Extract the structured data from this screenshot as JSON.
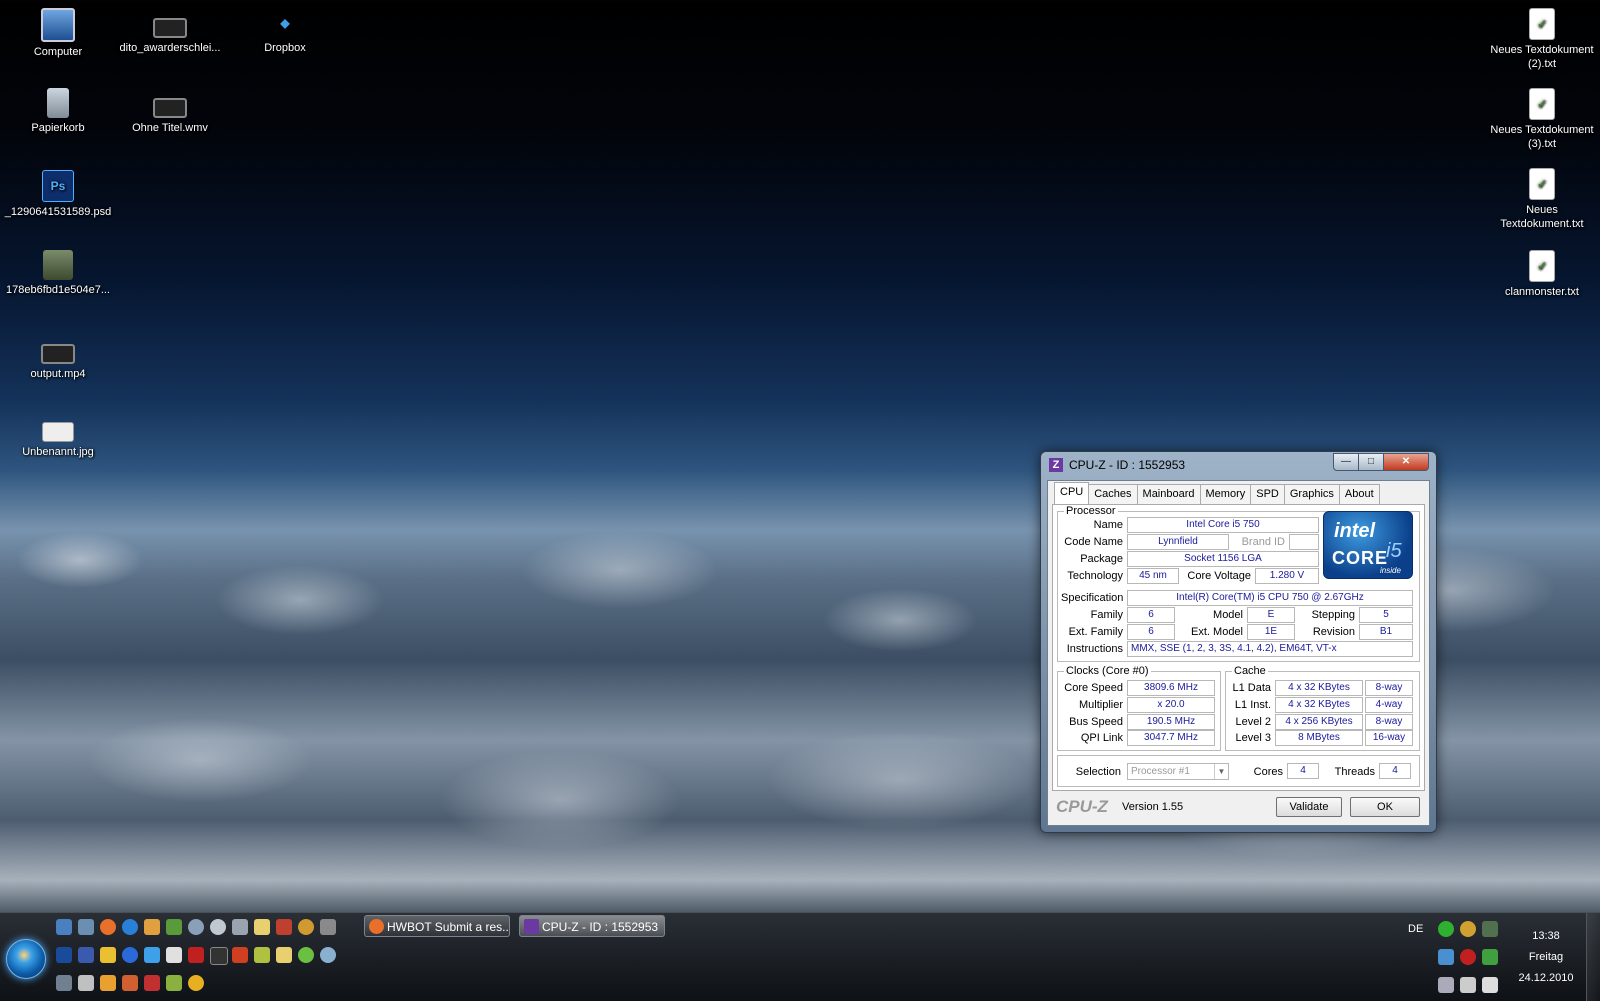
{
  "desktop_icons_left": [
    {
      "label": "Computer",
      "icon": "computer-icon"
    },
    {
      "label": "dito_awarderschlei...",
      "icon": "video-file-icon"
    },
    {
      "label": "Dropbox",
      "icon": "dropbox-icon"
    },
    {
      "label": "Papierkorb",
      "icon": "recycle-bin-icon"
    },
    {
      "label": "Ohne Titel.wmv",
      "icon": "video-file-icon"
    },
    {
      "label": "_1290641531589.psd",
      "icon": "psd-file-icon"
    },
    {
      "label": "178eb6fbd1e504e7...",
      "icon": "image-file-icon"
    },
    {
      "label": "output.mp4",
      "icon": "video-file-icon"
    },
    {
      "label": "Unbenannt.jpg",
      "icon": "image-file-icon"
    }
  ],
  "desktop_icons_right": [
    {
      "label": "Neues Textdokument (2).txt"
    },
    {
      "label": "Neues Textdokument (3).txt"
    },
    {
      "label": "Neues Textdokument.txt"
    },
    {
      "label": "clanmonster.txt"
    }
  ],
  "cpuz": {
    "title": "CPU-Z - ID : 1552953",
    "window_buttons": {
      "minimize": "—",
      "maximize": "□",
      "close": "✕"
    },
    "tabs": [
      "CPU",
      "Caches",
      "Mainboard",
      "Memory",
      "SPD",
      "Graphics",
      "About"
    ],
    "processor": {
      "legend": "Processor",
      "name_label": "Name",
      "name": "Intel Core i5 750",
      "codename_label": "Code Name",
      "codename": "Lynnfield",
      "brandid_label": "Brand ID",
      "brandid": "",
      "package_label": "Package",
      "package": "Socket 1156 LGA",
      "technology_label": "Technology",
      "technology": "45 nm",
      "corevoltage_label": "Core Voltage",
      "corevoltage": "1.280 V",
      "spec_label": "Specification",
      "spec": "Intel(R) Core(TM) i5 CPU       750  @ 2.67GHz",
      "family_label": "Family",
      "family": "6",
      "model_label": "Model",
      "model": "E",
      "stepping_label": "Stepping",
      "stepping": "5",
      "extfamily_label": "Ext. Family",
      "extfamily": "6",
      "extmodel_label": "Ext. Model",
      "extmodel": "1E",
      "revision_label": "Revision",
      "revision": "B1",
      "instructions_label": "Instructions",
      "instructions": "MMX, SSE (1, 2, 3, 3S, 4.1, 4.2), EM64T, VT-x"
    },
    "logo": {
      "brand": "intel",
      "line": "CORE",
      "model": "i5",
      "tag": "inside"
    },
    "clocks": {
      "legend": "Clocks (Core #0)",
      "corespeed_label": "Core Speed",
      "corespeed": "3809.6 MHz",
      "multiplier_label": "Multiplier",
      "multiplier": "x 20.0",
      "busspeed_label": "Bus Speed",
      "busspeed": "190.5 MHz",
      "qpi_label": "QPI Link",
      "qpi": "3047.7 MHz"
    },
    "cache": {
      "legend": "Cache",
      "rows": [
        {
          "label": "L1 Data",
          "size": "4 x 32 KBytes",
          "way": "8-way"
        },
        {
          "label": "L1 Inst.",
          "size": "4 x 32 KBytes",
          "way": "4-way"
        },
        {
          "label": "Level 2",
          "size": "4 x 256 KBytes",
          "way": "8-way"
        },
        {
          "label": "Level 3",
          "size": "8 MBytes",
          "way": "16-way"
        }
      ]
    },
    "selection_label": "Selection",
    "selection": "Processor #1",
    "cores_label": "Cores",
    "cores": "4",
    "threads_label": "Threads",
    "threads": "4",
    "brand_text": "CPU-Z",
    "version": "Version 1.55",
    "validate_label": "Validate",
    "ok_label": "OK"
  },
  "taskbar": {
    "tasks": [
      {
        "label": "HWBOT Submit a res...",
        "icon": "firefox-icon",
        "color": "#e8702a"
      },
      {
        "label": "CPU-Z - ID : 1552953",
        "icon": "cpuz-icon",
        "color": "#6a3aa0"
      }
    ],
    "language": "DE",
    "time": "13:38",
    "day": "Freitag",
    "date": "24.12.2010"
  }
}
